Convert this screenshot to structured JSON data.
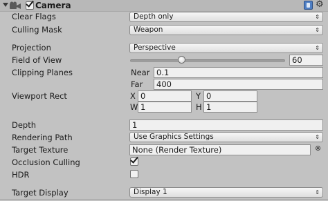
{
  "component": {
    "title": "Camera",
    "enabled": true
  },
  "fields": {
    "clear_flags": {
      "label": "Clear Flags",
      "value": "Depth only"
    },
    "culling_mask": {
      "label": "Culling Mask",
      "value": "Weapon"
    },
    "projection": {
      "label": "Projection",
      "value": "Perspective"
    },
    "field_of_view": {
      "label": "Field of View",
      "value": "60"
    },
    "clipping_planes": {
      "label": "Clipping Planes",
      "near_label": "Near",
      "near_value": "0.1",
      "far_label": "Far",
      "far_value": "400"
    },
    "viewport_rect": {
      "label": "Viewport Rect",
      "x_label": "X",
      "x_value": "0",
      "y_label": "Y",
      "y_value": "0",
      "w_label": "W",
      "w_value": "1",
      "h_label": "H",
      "h_value": "1"
    },
    "depth": {
      "label": "Depth",
      "value": "1"
    },
    "rendering_path": {
      "label": "Rendering Path",
      "value": "Use Graphics Settings"
    },
    "target_texture": {
      "label": "Target Texture",
      "value": "None (Render Texture)"
    },
    "occlusion_culling": {
      "label": "Occlusion Culling",
      "checked": true
    },
    "hdr": {
      "label": "HDR",
      "checked": false
    },
    "target_display": {
      "label": "Target Display",
      "value": "Display 1"
    }
  },
  "icons": {
    "foldout": "triangle-down-icon",
    "camera": "camera-icon",
    "help": "book-help-icon",
    "settings": "gear-icon",
    "popup_arrow": "up-down-arrow-icon",
    "object_picker": "target-circle-icon"
  },
  "colors": {
    "background": "#c2c2c2",
    "header": "#b8b8b8",
    "field": "#f0f0f0",
    "help_icon": "#4f7fc4"
  }
}
